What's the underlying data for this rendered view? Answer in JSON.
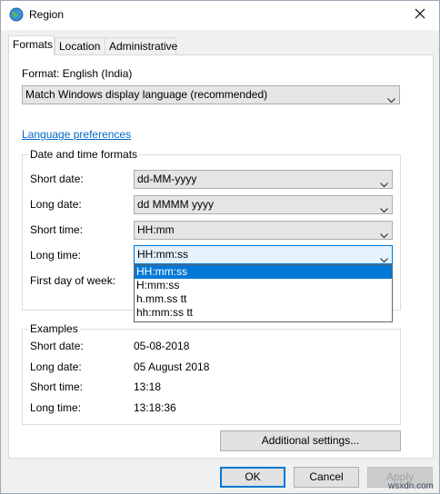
{
  "window": {
    "title": "Region",
    "close_glyph": "✕"
  },
  "tabs": [
    {
      "label": "Formats",
      "active": true
    },
    {
      "label": "Location",
      "active": false
    },
    {
      "label": "Administrative",
      "active": false
    }
  ],
  "format": {
    "label": "Format: English (India)",
    "selected": "Match Windows display language (recommended)"
  },
  "language_link": "Language preferences",
  "date_time_formats": {
    "title": "Date and time formats",
    "rows": [
      {
        "label": "Short date:",
        "value": "dd-MM-yyyy"
      },
      {
        "label": "Long date:",
        "value": "dd MMMM yyyy"
      },
      {
        "label": "Short time:",
        "value": "HH:mm"
      },
      {
        "label": "Long time:",
        "value": "HH:mm:ss"
      },
      {
        "label": "First day of week:",
        "value": ""
      }
    ],
    "long_time_options": [
      "HH:mm:ss",
      "H:mm:ss",
      "h.mm.ss tt",
      "hh:mm:ss tt"
    ]
  },
  "examples": {
    "title": "Examples",
    "rows": [
      {
        "label": "Short date:",
        "value": "05-08-2018"
      },
      {
        "label": "Long date:",
        "value": "05 August 2018"
      },
      {
        "label": "Short time:",
        "value": "13:18"
      },
      {
        "label": "Long time:",
        "value": "13:18:36"
      }
    ]
  },
  "buttons": {
    "additional": "Additional settings...",
    "ok": "OK",
    "cancel": "Cancel",
    "apply": "Apply"
  },
  "watermark": "wsxdn.com",
  "colors": {
    "accent": "#0078d7",
    "link": "#0066cc"
  },
  "icons": {
    "title": "globe-icon",
    "close": "close-icon",
    "combo_arrow": "chevron-down-icon"
  }
}
